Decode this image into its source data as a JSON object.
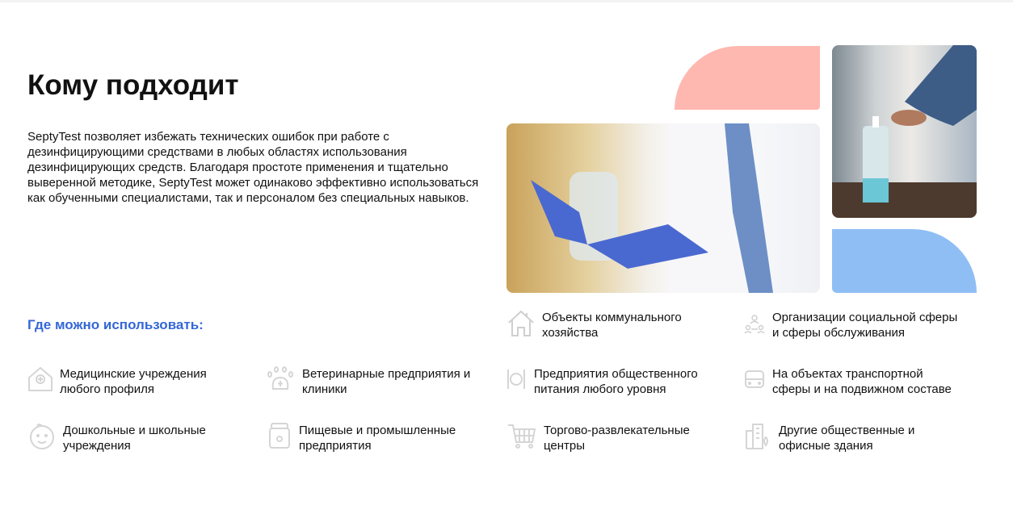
{
  "title": "Кому подходит",
  "description": "SeptyTest позволяет избежать технических ошибок при работе с дезинфицирующими средствами в любых областях использования дезинфицирующих средств. Благодаря простоте применения и тщательно выверенной методике, SeptyTest может одинаково эффективно использоваться как обученными специалистами, так и персоналом без специальных навыков.",
  "subtitle": "Где можно использовать:",
  "colors": {
    "accent": "#3467d6",
    "pink": "#ffb8b0",
    "blue": "#8fbef5",
    "icon": "#cfcfcf"
  },
  "items": [
    {
      "icon": "house-icon",
      "line1": "Объекты коммунального",
      "line2": "хозяйства"
    },
    {
      "icon": "people-icon",
      "line1": "Организации социальной сферы",
      "line2": "и сферы обслуживания"
    },
    {
      "icon": "medical-house-icon",
      "line1": "Медицинские учреждения",
      "line2": "любого профиля"
    },
    {
      "icon": "paw-icon",
      "line1": "Ветеринарные предприятия и",
      "line2": "клиники"
    },
    {
      "icon": "plate-cutlery-icon",
      "line1": "Предприятия общественного",
      "line2": "питания любого уровня"
    },
    {
      "icon": "bus-icon",
      "line1": "На объектах транспортной",
      "line2": "сферы и на подвижном составе"
    },
    {
      "icon": "baby-icon",
      "line1": "Дошкольные и школьные",
      "line2": "учреждения"
    },
    {
      "icon": "jar-icon",
      "line1": "Пищевые и промышленные",
      "line2": "предприятия"
    },
    {
      "icon": "cart-icon",
      "line1": "Торгово-развлекательные",
      "line2": "центры"
    },
    {
      "icon": "building-icon",
      "line1": "Другие общественные и",
      "line2": "офисные здания"
    }
  ]
}
